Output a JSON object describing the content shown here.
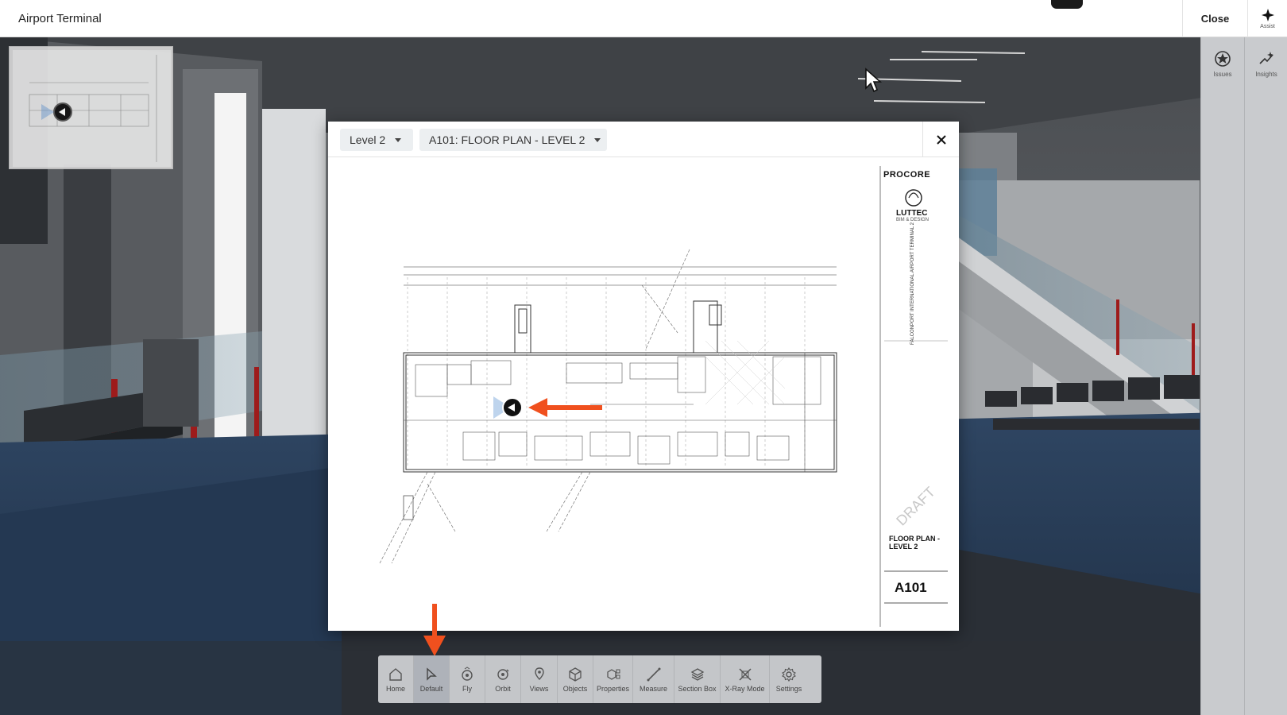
{
  "header": {
    "title": "Airport Terminal",
    "close_label": "Close",
    "assist_label": "Assist"
  },
  "rail": {
    "issues_label": "Issues",
    "insights_label": "Insights"
  },
  "modal": {
    "level_select": "Level 2",
    "sheet_select": "A101: FLOOR PLAN - LEVEL 2",
    "titleblock": {
      "brand": "PROCORE",
      "firm": "LUTTEC",
      "firm_sub": "BIM & DESIGN",
      "project": "FALCONPORT INTERNATIONAL AIRPORT TERMINAL 2",
      "watermark": "DRAFT",
      "sheet_title": "FLOOR PLAN - LEVEL 2",
      "sheet_number": "A101"
    }
  },
  "toolbar": {
    "tools": [
      {
        "label": "Home",
        "icon": "home-icon",
        "active": false
      },
      {
        "label": "Default",
        "icon": "cursor-icon",
        "active": true
      },
      {
        "label": "Fly",
        "icon": "fly-icon",
        "active": false
      },
      {
        "label": "Orbit",
        "icon": "orbit-icon",
        "active": false
      },
      {
        "label": "Views",
        "icon": "map-pin-icon",
        "active": false
      },
      {
        "label": "Objects",
        "icon": "cube-icon",
        "active": false
      },
      {
        "label": "Properties",
        "icon": "properties-icon",
        "active": false
      },
      {
        "label": "Measure",
        "icon": "ruler-icon",
        "active": false
      },
      {
        "label": "Section Box",
        "icon": "section-box-icon",
        "active": false
      },
      {
        "label": "X-Ray Mode",
        "icon": "xray-icon",
        "active": false
      },
      {
        "label": "Settings",
        "icon": "gear-icon",
        "active": false
      }
    ]
  },
  "colors": {
    "annotation_arrow": "#f0501e",
    "floor": "#263a54",
    "railing_post": "#9e1b1b"
  }
}
